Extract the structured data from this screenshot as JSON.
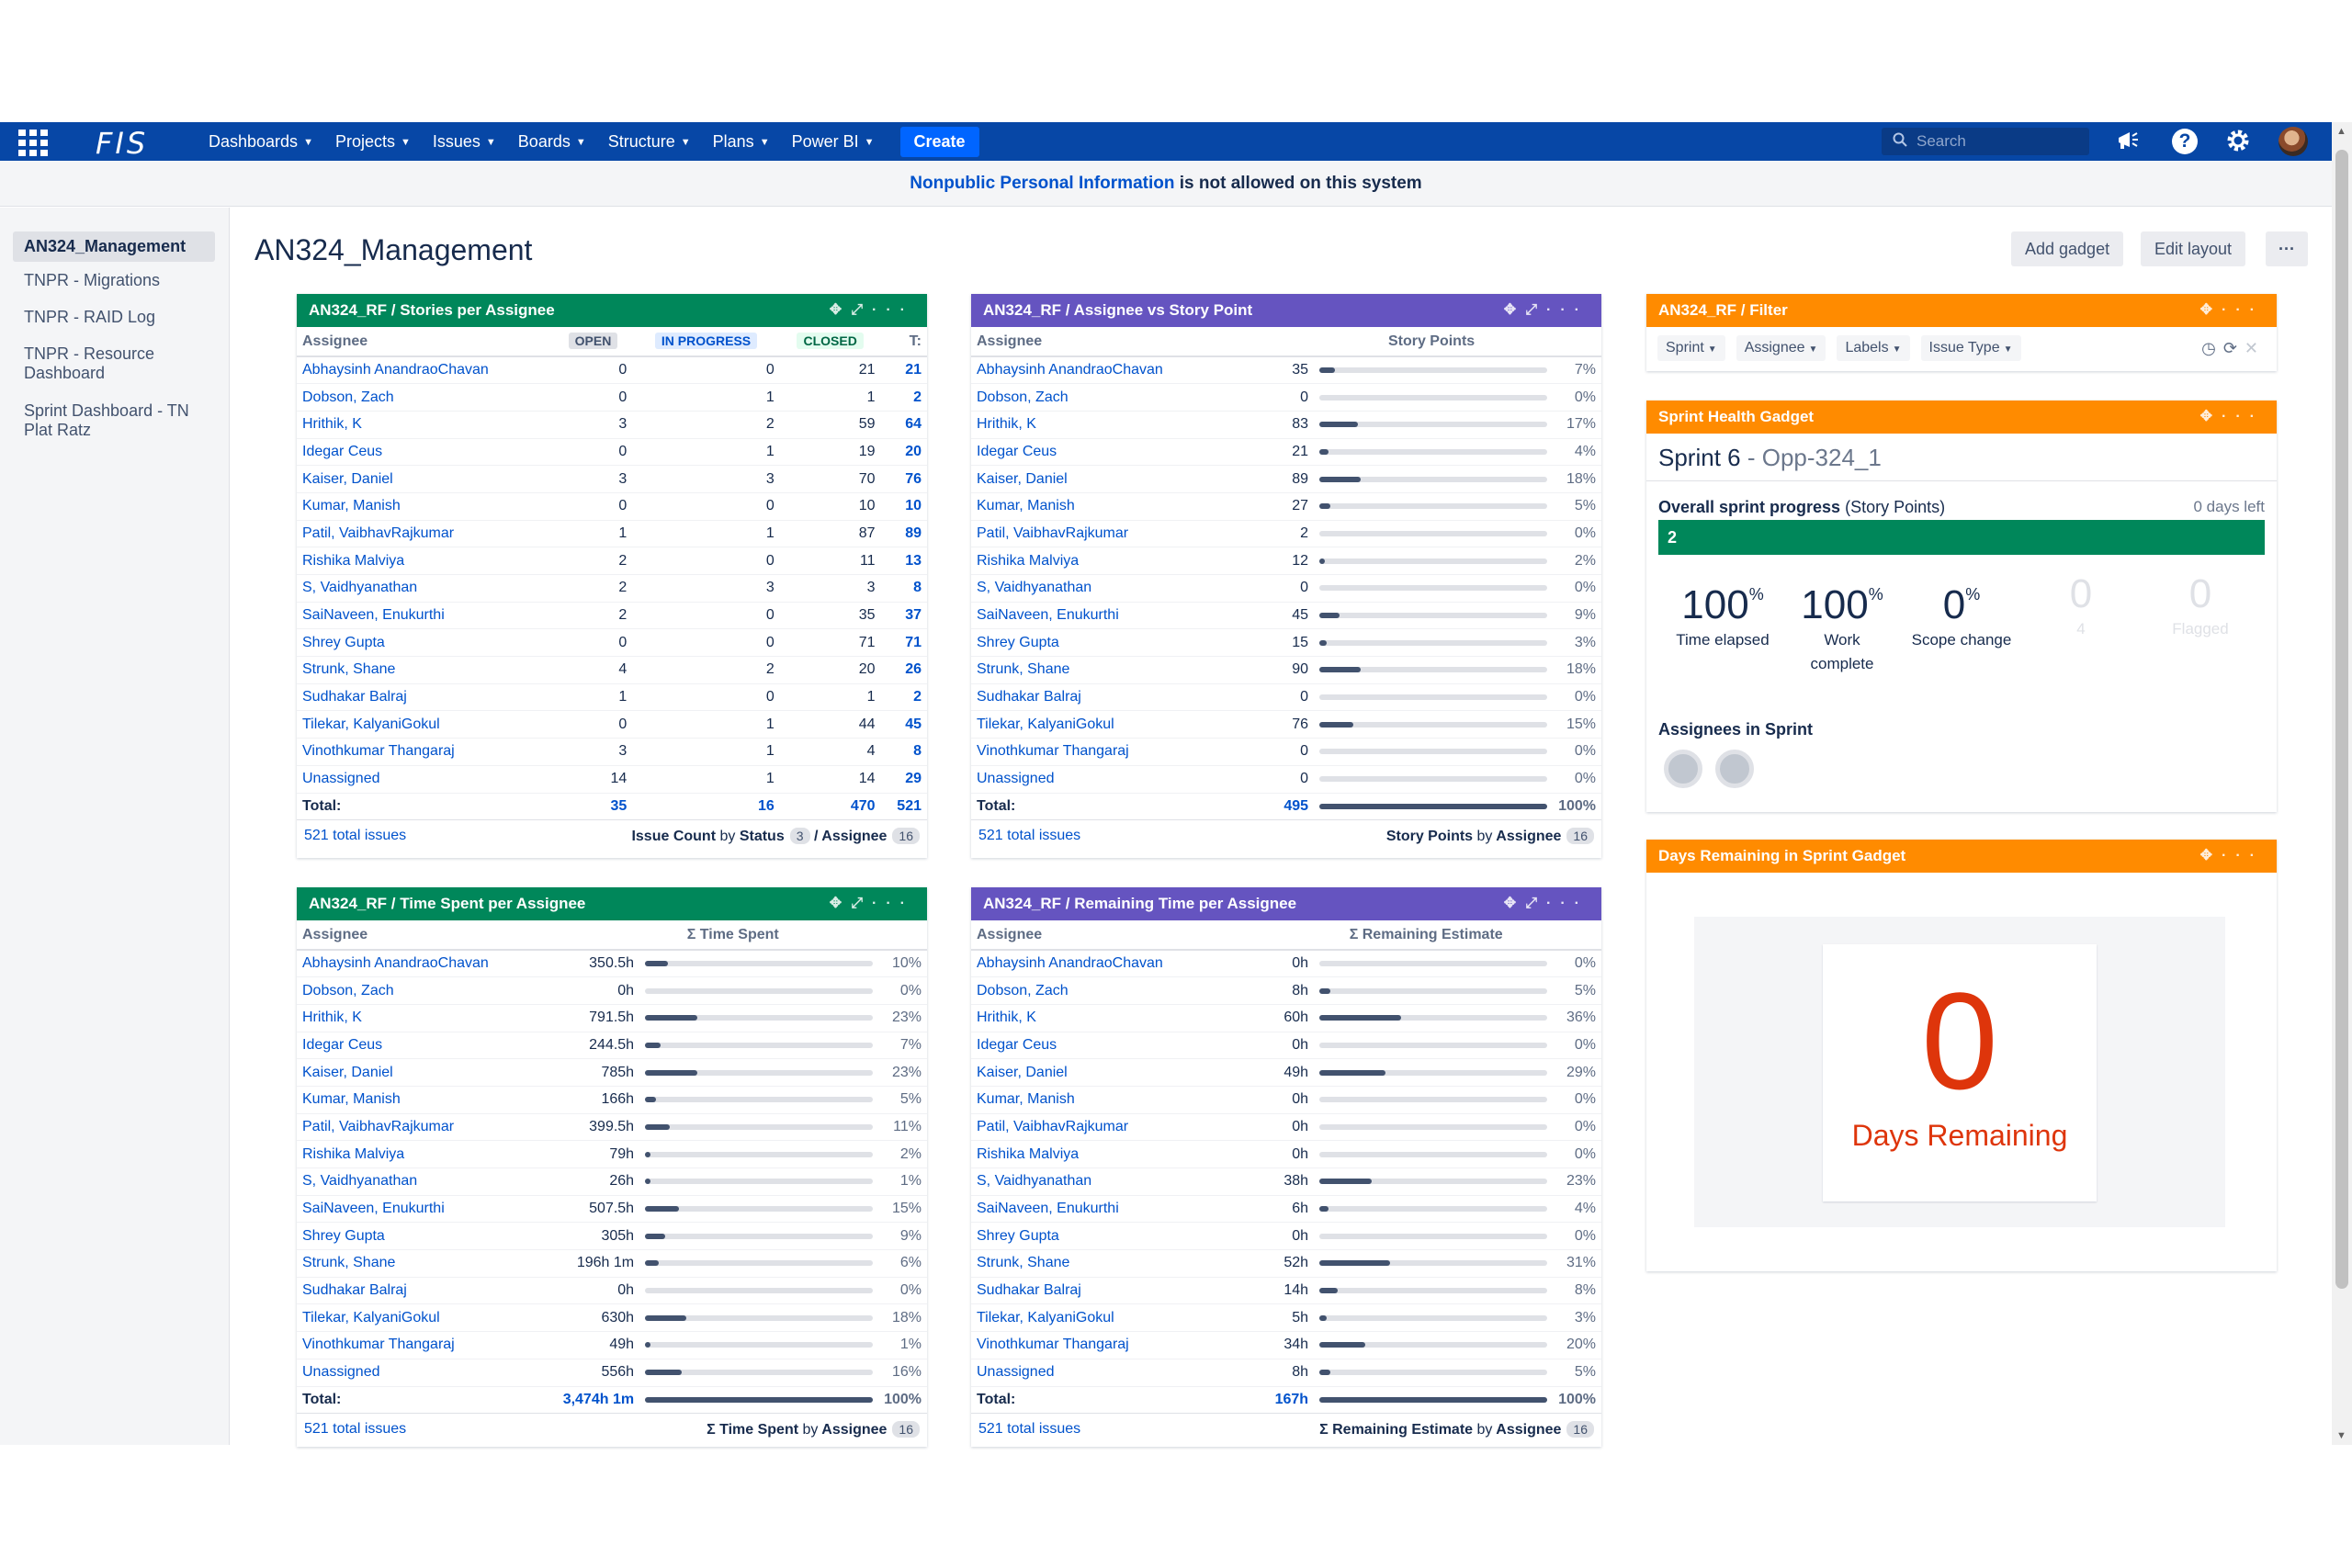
{
  "nav": {
    "logo": "FIS",
    "items": [
      "Dashboards",
      "Projects",
      "Issues",
      "Boards",
      "Structure",
      "Plans",
      "Power BI"
    ],
    "create": "Create",
    "search_placeholder": "Search"
  },
  "banner": {
    "highlight": "Nonpublic Personal Information",
    "rest": " is not allowed on this system"
  },
  "sidebar": [
    "AN324_Management",
    "TNPR - Migrations",
    "TNPR - RAID Log",
    "TNPR - Resource Dashboard",
    "Sprint Dashboard - TN Plat Ratz"
  ],
  "page": {
    "title": "AN324_Management",
    "add_gadget": "Add gadget",
    "edit_layout": "Edit layout",
    "more": "···"
  },
  "stories": {
    "title": "AN324_RF / Stories per Assignee",
    "cols": [
      "Assignee",
      "OPEN",
      "IN PROGRESS",
      "CLOSED",
      "T:"
    ],
    "rows": [
      [
        "Abhaysinh AnandraoChavan",
        "0",
        "0",
        "21",
        "21"
      ],
      [
        "Dobson, Zach",
        "0",
        "1",
        "1",
        "2"
      ],
      [
        "Hrithik, K",
        "3",
        "2",
        "59",
        "64"
      ],
      [
        "Idegar Ceus",
        "0",
        "1",
        "19",
        "20"
      ],
      [
        "Kaiser, Daniel",
        "3",
        "3",
        "70",
        "76"
      ],
      [
        "Kumar, Manish",
        "0",
        "0",
        "10",
        "10"
      ],
      [
        "Patil, VaibhavRajkumar",
        "1",
        "1",
        "87",
        "89"
      ],
      [
        "Rishika Malviya",
        "2",
        "0",
        "11",
        "13"
      ],
      [
        "S, Vaidhyanathan",
        "2",
        "3",
        "3",
        "8"
      ],
      [
        "SaiNaveen, Enukurthi",
        "2",
        "0",
        "35",
        "37"
      ],
      [
        "Shrey Gupta",
        "0",
        "0",
        "71",
        "71"
      ],
      [
        "Strunk, Shane",
        "4",
        "2",
        "20",
        "26"
      ],
      [
        "Sudhakar Balraj",
        "1",
        "0",
        "1",
        "2"
      ],
      [
        "Tilekar, KalyaniGokul",
        "0",
        "1",
        "44",
        "45"
      ],
      [
        "Vinothkumar Thangaraj",
        "3",
        "1",
        "4",
        "8"
      ],
      [
        "Unassigned",
        "14",
        "1",
        "14",
        "29"
      ]
    ],
    "total": [
      "Total:",
      "35",
      "16",
      "470",
      "521"
    ],
    "foot_left": "521 total issues",
    "foot_right_a": "Issue Count",
    "foot_right_b": "by",
    "foot_right_c": "Status",
    "foot_badge1": "3",
    "foot_right_d": "/ Assignee",
    "foot_badge2": "16"
  },
  "storypoints": {
    "title": "AN324_RF / Assignee vs Story Point",
    "cols": [
      "Assignee",
      "Story Points"
    ],
    "rows": [
      [
        "Abhaysinh AnandraoChavan",
        "35",
        7,
        "7%"
      ],
      [
        "Dobson, Zach",
        "0",
        0,
        "0%"
      ],
      [
        "Hrithik, K",
        "83",
        17,
        "17%"
      ],
      [
        "Idegar Ceus",
        "21",
        4,
        "4%"
      ],
      [
        "Kaiser, Daniel",
        "89",
        18,
        "18%"
      ],
      [
        "Kumar, Manish",
        "27",
        5,
        "5%"
      ],
      [
        "Patil, VaibhavRajkumar",
        "2",
        0,
        "0%"
      ],
      [
        "Rishika Malviya",
        "12",
        2,
        "2%"
      ],
      [
        "S, Vaidhyanathan",
        "0",
        0,
        "0%"
      ],
      [
        "SaiNaveen, Enukurthi",
        "45",
        9,
        "9%"
      ],
      [
        "Shrey Gupta",
        "15",
        3,
        "3%"
      ],
      [
        "Strunk, Shane",
        "90",
        18,
        "18%"
      ],
      [
        "Sudhakar Balraj",
        "0",
        0,
        "0%"
      ],
      [
        "Tilekar, KalyaniGokul",
        "76",
        15,
        "15%"
      ],
      [
        "Vinothkumar Thangaraj",
        "0",
        0,
        "0%"
      ],
      [
        "Unassigned",
        "0",
        0,
        "0%"
      ]
    ],
    "total": [
      "Total:",
      "495",
      100,
      "100%"
    ],
    "foot_left": "521 total issues",
    "foot_right_a": "Story Points",
    "foot_right_b": "by",
    "foot_right_c": "Assignee",
    "foot_badge": "16"
  },
  "timespent": {
    "title": "AN324_RF / Time Spent per Assignee",
    "cols": [
      "Assignee",
      "Σ Time Spent"
    ],
    "rows": [
      [
        "Abhaysinh AnandraoChavan",
        "350.5h",
        10,
        "10%"
      ],
      [
        "Dobson, Zach",
        "0h",
        0,
        "0%"
      ],
      [
        "Hrithik, K",
        "791.5h",
        23,
        "23%"
      ],
      [
        "Idegar Ceus",
        "244.5h",
        7,
        "7%"
      ],
      [
        "Kaiser, Daniel",
        "785h",
        23,
        "23%"
      ],
      [
        "Kumar, Manish",
        "166h",
        5,
        "5%"
      ],
      [
        "Patil, VaibhavRajkumar",
        "399.5h",
        11,
        "11%"
      ],
      [
        "Rishika Malviya",
        "79h",
        2,
        "2%"
      ],
      [
        "S, Vaidhyanathan",
        "26h",
        1,
        "1%"
      ],
      [
        "SaiNaveen, Enukurthi",
        "507.5h",
        15,
        "15%"
      ],
      [
        "Shrey Gupta",
        "305h",
        9,
        "9%"
      ],
      [
        "Strunk, Shane",
        "196h 1m",
        6,
        "6%"
      ],
      [
        "Sudhakar Balraj",
        "0h",
        0,
        "0%"
      ],
      [
        "Tilekar, KalyaniGokul",
        "630h",
        18,
        "18%"
      ],
      [
        "Vinothkumar Thangaraj",
        "49h",
        1,
        "1%"
      ],
      [
        "Unassigned",
        "556h",
        16,
        "16%"
      ]
    ],
    "total": [
      "Total:",
      "3,474h 1m",
      100,
      "100%"
    ],
    "foot_left": "521 total issues",
    "foot_right_a": "Σ Time Spent",
    "foot_right_b": "by",
    "foot_right_c": "Assignee",
    "foot_badge": "16"
  },
  "remaining": {
    "title": "AN324_RF / Remaining Time per Assignee",
    "cols": [
      "Assignee",
      "Σ Remaining Estimate"
    ],
    "rows": [
      [
        "Abhaysinh AnandraoChavan",
        "0h",
        0,
        "0%"
      ],
      [
        "Dobson, Zach",
        "8h",
        5,
        "5%"
      ],
      [
        "Hrithik, K",
        "60h",
        36,
        "36%"
      ],
      [
        "Idegar Ceus",
        "0h",
        0,
        "0%"
      ],
      [
        "Kaiser, Daniel",
        "49h",
        29,
        "29%"
      ],
      [
        "Kumar, Manish",
        "0h",
        0,
        "0%"
      ],
      [
        "Patil, VaibhavRajkumar",
        "0h",
        0,
        "0%"
      ],
      [
        "Rishika Malviya",
        "0h",
        0,
        "0%"
      ],
      [
        "S, Vaidhyanathan",
        "38h",
        23,
        "23%"
      ],
      [
        "SaiNaveen, Enukurthi",
        "6h",
        4,
        "4%"
      ],
      [
        "Shrey Gupta",
        "0h",
        0,
        "0%"
      ],
      [
        "Strunk, Shane",
        "52h",
        31,
        "31%"
      ],
      [
        "Sudhakar Balraj",
        "14h",
        8,
        "8%"
      ],
      [
        "Tilekar, KalyaniGokul",
        "5h",
        3,
        "3%"
      ],
      [
        "Vinothkumar Thangaraj",
        "34h",
        20,
        "20%"
      ],
      [
        "Unassigned",
        "8h",
        5,
        "5%"
      ]
    ],
    "total": [
      "Total:",
      "167h",
      100,
      "100%"
    ],
    "foot_left": "521 total issues",
    "foot_right_a": "Σ Remaining Estimate",
    "foot_right_b": "by",
    "foot_right_c": "Assignee",
    "foot_badge": "16"
  },
  "filter": {
    "title": "AN324_RF / Filter",
    "buttons": [
      "Sprint",
      "Assignee",
      "Labels",
      "Issue Type"
    ]
  },
  "sprint": {
    "title": "Sprint Health Gadget",
    "name": "Sprint 6",
    "sep": " - ",
    "sub": "Opp-324_1",
    "progress_label": "Overall sprint progress",
    "progress_unit": " (Story Points)",
    "days_left": "0 days left",
    "bar_value": "2",
    "bar_fraction": 1.0,
    "metrics": [
      {
        "big": "100",
        "unit": "%",
        "cap": "Time elapsed",
        "dim": false
      },
      {
        "big": "100",
        "unit": "%",
        "cap": "Work complete",
        "dim": false
      },
      {
        "big": "0",
        "unit": "%",
        "cap": "Scope change",
        "dim": false
      },
      {
        "big": "0",
        "unit": "",
        "cap": "4",
        "dim": true
      },
      {
        "big": "0",
        "unit": "",
        "cap": "Flagged",
        "dim": true
      }
    ],
    "assignees_title": "Assignees in Sprint"
  },
  "days": {
    "title": "Days Remaining in Sprint Gadget",
    "number": "0",
    "label": "Days Remaining"
  },
  "colors": {
    "nav": "#0747a6",
    "green": "#00875a",
    "purple": "#6554c0",
    "orange": "#ff8b00",
    "link": "#0052cc",
    "red": "#de350b"
  }
}
